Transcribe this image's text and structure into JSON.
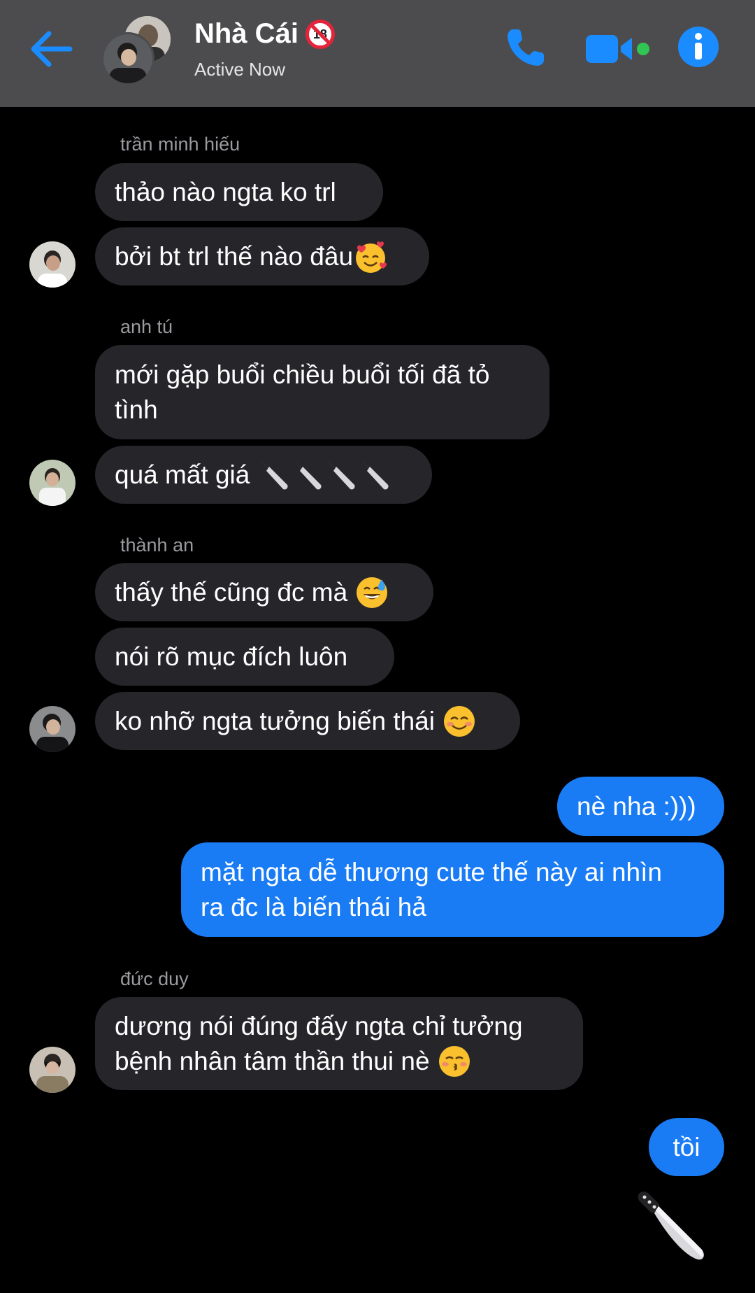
{
  "header": {
    "title": "Nhà Cái",
    "title_badge": "18",
    "status": "Active Now",
    "accent_color": "#1a8cff",
    "icons": [
      "back-arrow-icon",
      "phone-icon",
      "video-camera-icon",
      "info-icon"
    ]
  },
  "messages": {
    "group1": {
      "sender": "trần minh hiếu",
      "m1": "thảo nào ngta ko trl",
      "m2": "bởi bt trl thế nào đâu"
    },
    "group2": {
      "sender": "anh tú",
      "m1_line1": "mới gặp buổi chiều buổi tối đã tỏ",
      "m1_line2": "tình",
      "m2": "quá mất giá"
    },
    "group3": {
      "sender": "thành an",
      "m1": "thấy thế cũng đc mà",
      "m2": "nói rõ mục đích luôn",
      "m3": "ko nhỡ ngta tưởng biến thái"
    },
    "group4": {
      "m1": "nè nha :)))",
      "m2_line1": "mặt ngta dễ thương cute thế này ai nhìn",
      "m2_line2": "ra đc là biến thái hả"
    },
    "group5": {
      "sender": "đức duy",
      "m1_line1": "dương nói đúng đấy ngta chỉ tưởng",
      "m1_line2": "bệnh nhân tâm thần thui nè"
    },
    "group6": {
      "m1": "tồi",
      "m2_emoji": "knife-icon"
    }
  },
  "colors": {
    "incoming_bubble": "#26252a",
    "outgoing_bubble": "#1a7cf5",
    "header_bg": "#4c4c4e",
    "background": "#000000"
  }
}
